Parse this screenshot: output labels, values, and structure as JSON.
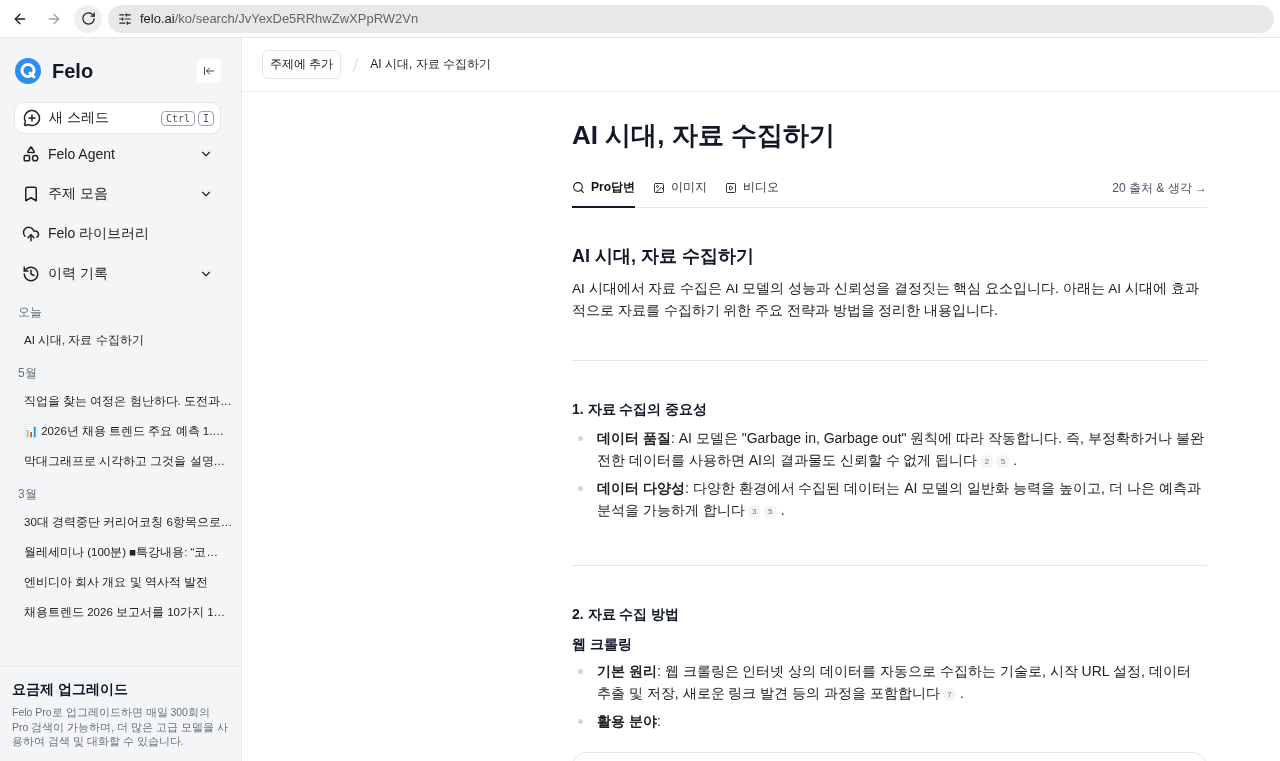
{
  "browser": {
    "url_host": "felo.ai",
    "url_path": "/ko/search/JvYexDe5RRhwZwXPpRW2Vn"
  },
  "sidebar": {
    "brand": "Felo",
    "new_thread": {
      "label": "새 스레드",
      "keys": [
        "Ctrl",
        "I"
      ]
    },
    "nav": [
      {
        "kind": "agent",
        "label": "Felo Agent",
        "has_menu": true
      },
      {
        "kind": "topics",
        "label": "주제 모음",
        "has_menu": true
      },
      {
        "kind": "library",
        "label": "Felo 라이브러리",
        "has_menu": false
      },
      {
        "kind": "history",
        "label": "이력 기록",
        "has_menu": true
      }
    ],
    "history": [
      {
        "group": "오늘",
        "items": [
          "AI 시대, 자료 수집하기"
        ]
      },
      {
        "group": "5월",
        "items": [
          "직업을 찾는 여정은 험난하다. 도전과…",
          "📊 2026년 채용 트렌드 주요 예측 1.…",
          "막대그래프로 시각하고 그것을 설명…"
        ]
      },
      {
        "group": "3월",
        "items": [
          "30대 경력중단 커리어코칭 6항목으로…",
          "월레세미나 (100분) ■특강내용: “코…",
          "엔비디아 회사 개요 및 역사적 발전",
          "채용트렌드 2026 보고서를 10가지 1…"
        ]
      }
    ],
    "upgrade": {
      "title": "요금제 업그레이드",
      "text": "Felo Pro로 업그레이드하면 매일 300회의 Pro 검색이 가능하며, 더 많은 고급 모델을 사용하여 검색 및 대화할 수 있습니다."
    }
  },
  "topbar": {
    "add_button": "주제에 추가",
    "breadcrumb": "AI 시대, 자료 수집하기"
  },
  "article": {
    "title": "AI 시대, 자료 수집하기",
    "tabs": [
      {
        "kind": "answer",
        "label": "Pro답변",
        "selected": true
      },
      {
        "kind": "image",
        "label": "이미지",
        "selected": false
      },
      {
        "kind": "video",
        "label": "비디오",
        "selected": false
      }
    ],
    "sources_link": "20 출처 & 생각 →",
    "heading": "AI 시대, 자료 수집하기",
    "intro": "AI 시대에서 자료 수집은 AI 모델의 성능과 신뢰성을 결정짓는 핵심 요소입니다. 아래는 AI 시대에 효과적으로 자료를 수집하기 위한 주요 전략과 방법을 정리한 내용입니다.",
    "sections": [
      {
        "heading": "1. 자료 수집의 중요성",
        "blocks": [
          {
            "kind": "list",
            "items": [
              {
                "label": "데이터 품질",
                "text": ": AI 모델은 \"Garbage in, Garbage out\" 원칙에 따라 작동합니다. 즉, 부정확하거나 불완전한 데이터를 사용하면 AI의 결과물도 신뢰할 수 없게 됩니다",
                "citations": [
                  "2",
                  "5"
                ],
                "end": "."
              },
              {
                "label": "데이터 다양성",
                "text": ": 다양한 환경에서 수집된 데이터는 AI 모델의 일반화 능력을 높이고, 더 나은 예측과 분석을 가능하게 합니다",
                "citations": [
                  "3",
                  "5"
                ],
                "end": "."
              }
            ]
          }
        ]
      },
      {
        "heading": "2. 자료 수집 방법",
        "blocks": [
          {
            "kind": "subheading",
            "text": "웹 크롤링"
          },
          {
            "kind": "list",
            "items": [
              {
                "label": "기본 원리",
                "text": ": 웹 크롤링은 인터넷 상의 데이터를 자동으로 수집하는 기술로, 시작 URL 설정, 데이터 추출 및 저장, 새로운 링크 발견 등의 과정을 포함합니다",
                "citations": [
                  "7"
                ],
                "end": "."
              },
              {
                "label": "활용 분야",
                "text": ":"
              }
            ]
          },
          {
            "kind": "card"
          }
        ]
      }
    ]
  }
}
